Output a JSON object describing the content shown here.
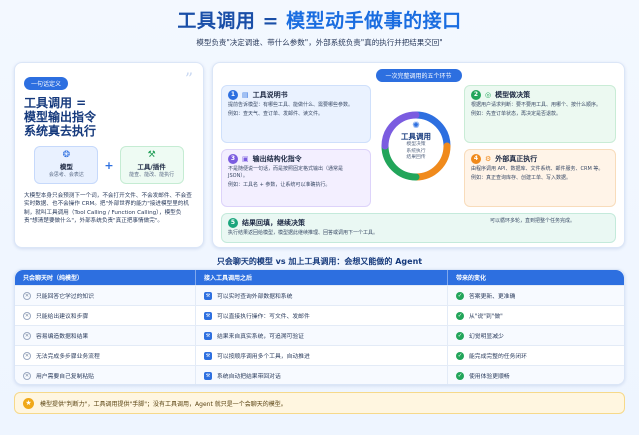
{
  "header": {
    "title_a": "工具调用 = ",
    "title_b": "模型动手做事的接口",
    "subtitle": "模型负责\"决定调谁、带什么参数\"，外部系统负责\"真的执行并把结果交回\""
  },
  "left": {
    "badge": "一句话定义",
    "heading_1": "工具调用 =",
    "heading_2": "模型输出指令",
    "heading_3": "系统真去执行",
    "model_name": "模型",
    "model_sub": "会思考、会表达",
    "tool_name": "工具/插件",
    "tool_sub": "能查、能改、能执行",
    "paragraph": "大模型本身只会预测下一个词，不会打开文件、不会发邮件、不会查实时数据、也不会操作 CRM。把\"外部世界的能力\"接进模型里的机制，就叫工具调用（Tool Calling / Function Calling），模型负责\"想清楚要做什么\"，外部系统负责\"真正把事情做完\"。"
  },
  "right": {
    "badge": "一次完整调用的五个环节",
    "center_title": "工具调用",
    "center_sub_1": "模型决策",
    "center_sub_2": "系统执行",
    "center_sub_3": "结果回传",
    "steps": [
      {
        "num": "1",
        "title": "工具说明书",
        "line_a": "提前告诉模型：有哪些工具、能做什么、需要哪些参数。",
        "line_b": "例如：查天气、查订单、发邮件、读文件。"
      },
      {
        "num": "2",
        "title": "模型做决策",
        "line_a": "根据用户请求判断：要不要用工具、用哪个、按什么顺序。",
        "line_b": "例如：先查订单状态，再决定是否退款。"
      },
      {
        "num": "3",
        "title": "输出结构化指令",
        "line_a": "不是随便说一句话，而是按照固定格式输出（通常是 JSON）。",
        "line_b": "例如：工具名 + 参数，让系统可以准确执行。"
      },
      {
        "num": "4",
        "title": "外部真正执行",
        "line_a": "由程序调用 API、数据库、文件系统、邮件服务、CRM 等。",
        "line_b": "例如：真正查询库存、创建工单、写入数据。"
      },
      {
        "num": "5",
        "title": "结果回填，继续决策",
        "line_a": "执行结果返回给模型，模型据此继续推理、回答或调用下一个工具。",
        "line_b": "可以循环多轮，直到把整个任务完成。"
      }
    ]
  },
  "comparison": {
    "title": "只会聊天的模型 vs 加上工具调用：会想又能做的 Agent",
    "headers": [
      "只会聊天时（纯模型）",
      "接入工具调用之后",
      "带来的变化"
    ],
    "rows": [
      [
        "只能回答它学过的知识",
        "可以实时查询外部数据和系统",
        "答案更新、更准确"
      ],
      [
        "只能给出建议和步骤",
        "可以直接执行操作：写文件、发邮件",
        "从\"说\"到\"做\""
      ],
      [
        "容易编造数据和结果",
        "结果来自真实系统，可追溯可验证",
        "幻觉明显减少"
      ],
      [
        "无法完成多步骤业务流程",
        "可以按顺序调用多个工具，自动推进",
        "能完成完整的任务闭环"
      ],
      [
        "用户需要自己复制粘贴",
        "系统自动把结果带回对话",
        "使用体验更顺畅"
      ]
    ]
  },
  "footer": {
    "text": "模型提供\"判断力\"，工具调用提供\"手脚\"；没有工具调用，Agent 就只是一个会聊天的模型。"
  }
}
